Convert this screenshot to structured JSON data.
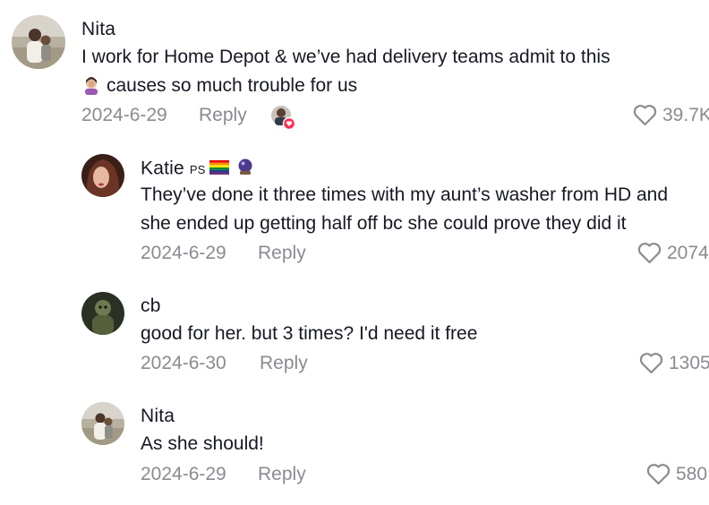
{
  "comments": [
    {
      "username": "Nita",
      "text_line1": "I work for Home Depot & we’ve had delivery teams admit to this",
      "text_line2": "causes so much trouble for us",
      "date": "2024-6-29",
      "reply_label": "Reply",
      "likes": "39.7K",
      "creator_liked": true,
      "emoji": "woman-facepalming-icon"
    },
    {
      "username": "Katie",
      "badge": "PS",
      "text_line1": "They’ve done it three times with my aunt’s washer from HD and",
      "text_line2": "she ended up getting half off bc she could prove they did it",
      "date": "2024-6-29",
      "reply_label": "Reply",
      "likes": "2074"
    },
    {
      "username": "cb",
      "text_line1": "good for her. but 3 times? I'd need it free",
      "date": "2024-6-30",
      "reply_label": "Reply",
      "likes": "1305"
    },
    {
      "username": "Nita",
      "text_line1": "As she should!",
      "date": "2024-6-29",
      "reply_label": "Reply",
      "likes": "580"
    }
  ],
  "colors": {
    "text_primary": "#161823",
    "text_secondary": "#8a8b91",
    "like_badge": "#fe2c55"
  }
}
